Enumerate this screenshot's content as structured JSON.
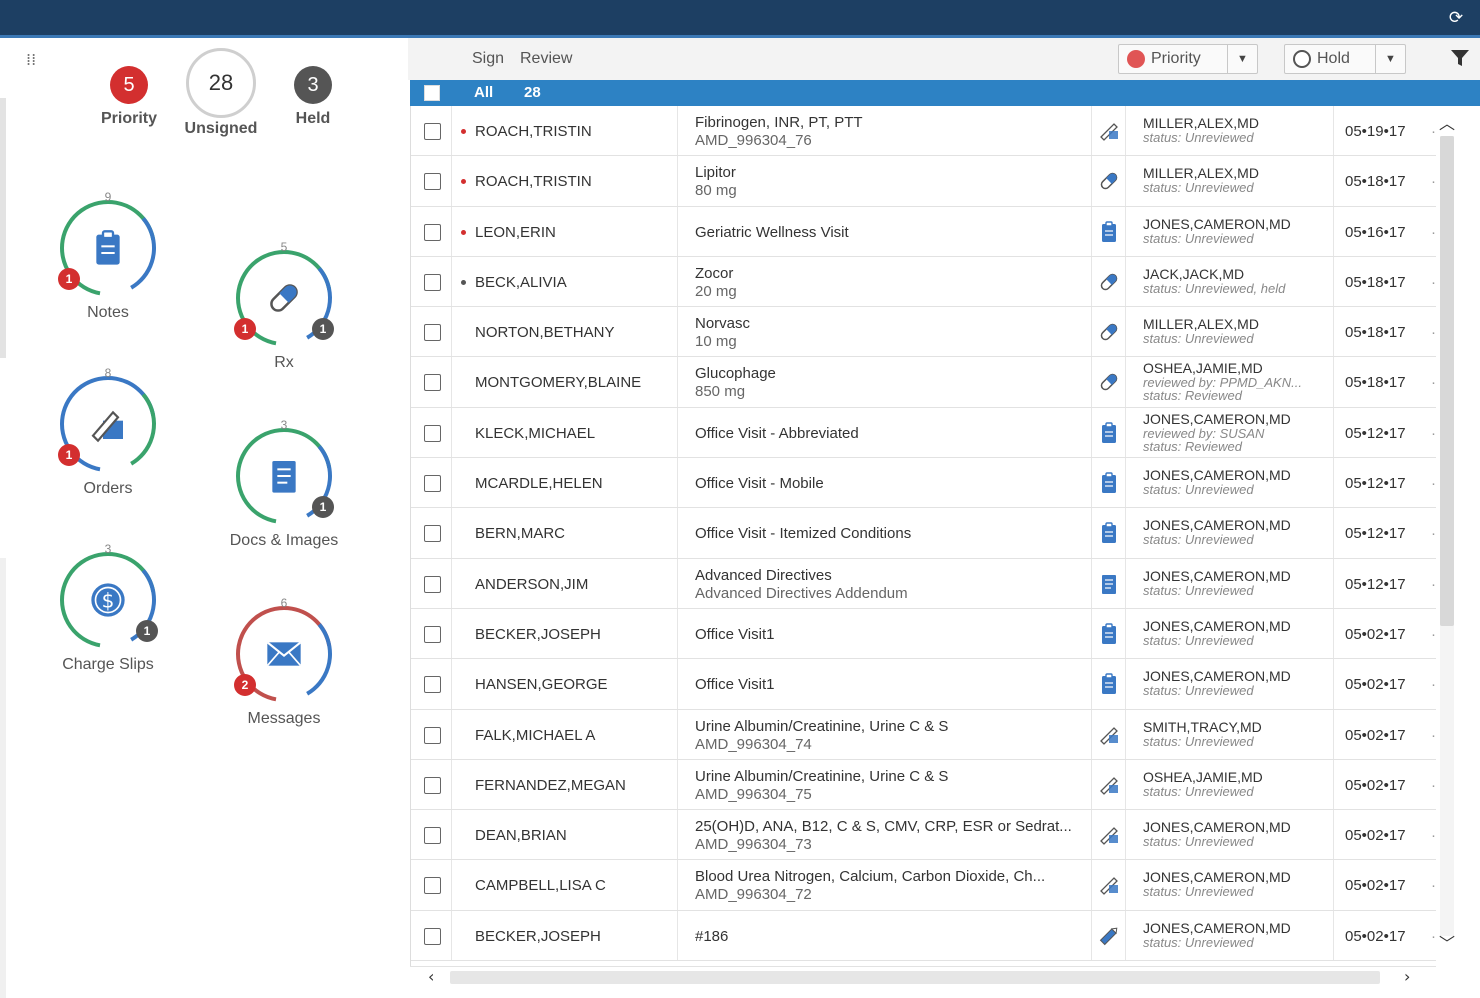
{
  "app": {
    "refresh_icon": "refresh-icon"
  },
  "summary": {
    "priority": {
      "count": "5",
      "label": "Priority",
      "color": "#d32f2f"
    },
    "unsigned": {
      "count": "28",
      "label": "Unsigned"
    },
    "held": {
      "count": "3",
      "label": "Held",
      "color": "#555555"
    }
  },
  "categories": [
    {
      "name": "Notes",
      "count": "9",
      "red_badge": "1",
      "dark_badge": "",
      "ring": [
        "#3aa36c",
        "#3a78c4"
      ],
      "icon": "clipboard-icon"
    },
    {
      "name": "Rx",
      "count": "5",
      "red_badge": "1",
      "dark_badge": "1",
      "ring": [
        "#3aa36c",
        "#3a78c4"
      ],
      "icon": "pill-icon"
    },
    {
      "name": "Orders",
      "count": "8",
      "red_badge": "1",
      "dark_badge": "",
      "ring": [
        "#3a78c4",
        "#3aa36c"
      ],
      "icon": "order-icon"
    },
    {
      "name": "Docs & Images",
      "count": "3",
      "red_badge": "",
      "dark_badge": "1",
      "ring": [
        "#3aa36c",
        "#3a78c4"
      ],
      "icon": "document-icon"
    },
    {
      "name": "Charge Slips",
      "count": "3",
      "red_badge": "",
      "dark_badge": "1",
      "ring": [
        "#3aa36c",
        "#3a78c4"
      ],
      "icon": "dollar-icon"
    },
    {
      "name": "Messages",
      "count": "6",
      "red_badge": "2",
      "dark_badge": "",
      "ring": [
        "#c0504d",
        "#3a78c4"
      ],
      "icon": "envelope-icon"
    }
  ],
  "toolbar": {
    "sign_label": "Sign",
    "review_label": "Review",
    "priority_label": "Priority",
    "hold_label": "Hold"
  },
  "list": {
    "all_label": "All",
    "all_count": "28",
    "rows": [
      {
        "patient": "ROACH,TRISTIN",
        "dot": "#d32f2f",
        "item": "Fibrinogen, INR, PT, PTT",
        "sub": "AMD_996304_76",
        "type": "flask",
        "provider": "MILLER,ALEX,MD",
        "status": [
          "status: Unreviewed"
        ],
        "date": "05•19•17"
      },
      {
        "patient": "ROACH,TRISTIN",
        "dot": "#d32f2f",
        "item": "Lipitor",
        "sub": "80 mg",
        "type": "pill",
        "provider": "MILLER,ALEX,MD",
        "status": [
          "status: Unreviewed"
        ],
        "date": "05•18•17"
      },
      {
        "patient": "LEON,ERIN",
        "dot": "#d32f2f",
        "item": "Geriatric Wellness Visit",
        "sub": "",
        "type": "clipboard",
        "provider": "JONES,CAMERON,MD",
        "status": [
          "status: Unreviewed"
        ],
        "date": "05•16•17"
      },
      {
        "patient": "BECK,ALIVIA",
        "dot": "#555555",
        "item": "Zocor",
        "sub": "20 mg",
        "type": "pill",
        "provider": "JACK,JACK,MD",
        "status": [
          "status: Unreviewed, held"
        ],
        "date": "05•18•17"
      },
      {
        "patient": "NORTON,BETHANY",
        "dot": "",
        "item": "Norvasc",
        "sub": "10 mg",
        "type": "pill",
        "provider": "MILLER,ALEX,MD",
        "status": [
          "status: Unreviewed"
        ],
        "date": "05•18•17"
      },
      {
        "patient": "MONTGOMERY,BLAINE",
        "dot": "",
        "item": "Glucophage",
        "sub": "850 mg",
        "type": "pill",
        "provider": "OSHEA,JAMIE,MD",
        "status": [
          "reviewed by: PPMD_AKN...",
          "status: Reviewed"
        ],
        "date": "05•18•17"
      },
      {
        "patient": "KLECK,MICHAEL",
        "dot": "",
        "item": "Office Visit - Abbreviated",
        "sub": "",
        "type": "clipboard",
        "provider": "JONES,CAMERON,MD",
        "status": [
          "reviewed by: SUSAN",
          "status: Reviewed"
        ],
        "date": "05•12•17"
      },
      {
        "patient": "MCARDLE,HELEN",
        "dot": "",
        "item": "Office Visit - Mobile",
        "sub": "",
        "type": "clipboard",
        "provider": "JONES,CAMERON,MD",
        "status": [
          "status: Unreviewed"
        ],
        "date": "05•12•17"
      },
      {
        "patient": "BERN,MARC",
        "dot": "",
        "item": "Office Visit - Itemized Conditions",
        "sub": "",
        "type": "clipboard",
        "provider": "JONES,CAMERON,MD",
        "status": [
          "status: Unreviewed"
        ],
        "date": "05•12•17"
      },
      {
        "patient": "ANDERSON,JIM",
        "dot": "",
        "item": "Advanced Directives",
        "sub": "Advanced Directives Addendum",
        "type": "document",
        "provider": "JONES,CAMERON,MD",
        "status": [
          "status: Unreviewed"
        ],
        "date": "05•12•17"
      },
      {
        "patient": "BECKER,JOSEPH",
        "dot": "",
        "item": "Office Visit1",
        "sub": "",
        "type": "clipboard",
        "provider": "JONES,CAMERON,MD",
        "status": [
          "status: Unreviewed"
        ],
        "date": "05•02•17"
      },
      {
        "patient": "HANSEN,GEORGE",
        "dot": "",
        "item": "Office Visit1",
        "sub": "",
        "type": "clipboard",
        "provider": "JONES,CAMERON,MD",
        "status": [
          "status: Unreviewed"
        ],
        "date": "05•02•17"
      },
      {
        "patient": "FALK,MICHAEL A",
        "dot": "",
        "item": "Urine Albumin/Creatinine, Urine C & S",
        "sub": "AMD_996304_74",
        "type": "flask",
        "provider": "SMITH,TRACY,MD",
        "status": [
          "status: Unreviewed"
        ],
        "date": "05•02•17"
      },
      {
        "patient": "FERNANDEZ,MEGAN",
        "dot": "",
        "item": "Urine Albumin/Creatinine, Urine C & S",
        "sub": "AMD_996304_75",
        "type": "flask",
        "provider": "OSHEA,JAMIE,MD",
        "status": [
          "status: Unreviewed"
        ],
        "date": "05•02•17"
      },
      {
        "patient": "DEAN,BRIAN",
        "dot": "",
        "item": "25(OH)D, ANA, B12, C & S, CMV, CRP, ESR or Sedrat...",
        "sub": "AMD_996304_73",
        "type": "flask",
        "provider": "JONES,CAMERON,MD",
        "status": [
          "status: Unreviewed"
        ],
        "date": "05•02•17"
      },
      {
        "patient": "CAMPBELL,LISA C",
        "dot": "",
        "item": "Blood Urea Nitrogen, Calcium, Carbon Dioxide, Ch...",
        "sub": "AMD_996304_72",
        "type": "flask",
        "provider": "JONES,CAMERON,MD",
        "status": [
          "status: Unreviewed"
        ],
        "date": "05•02•17"
      },
      {
        "patient": "BECKER,JOSEPH",
        "dot": "",
        "item": "#186",
        "sub": "",
        "type": "pencil",
        "provider": "JONES,CAMERON,MD",
        "status": [
          "status: Unreviewed"
        ],
        "date": "05•02•17"
      }
    ]
  }
}
